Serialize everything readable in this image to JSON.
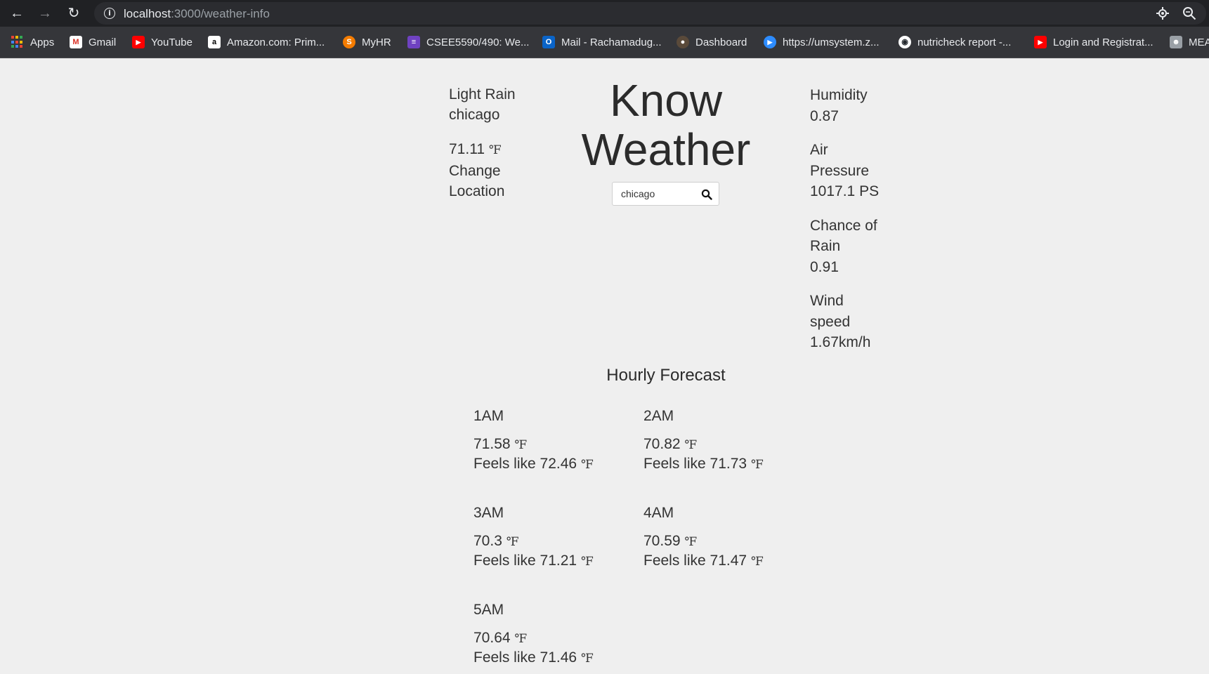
{
  "browser": {
    "url_host": "localhost",
    "url_path": ":3000/weather-info",
    "bookmarks": [
      {
        "label": "Apps",
        "icon": "apps-grid-icon"
      },
      {
        "label": "Gmail",
        "icon": "gmail-icon"
      },
      {
        "label": "YouTube",
        "icon": "youtube-icon"
      },
      {
        "label": "Amazon.com: Prim...",
        "icon": "amazon-icon"
      },
      {
        "label": "MyHR",
        "icon": "myhr-icon"
      },
      {
        "label": "CSEE5590/490: We...",
        "icon": "list-icon"
      },
      {
        "label": "Mail - Rachamadug...",
        "icon": "outlook-icon"
      },
      {
        "label": "Dashboard",
        "icon": "dashboard-icon"
      },
      {
        "label": "https://umsystem.z...",
        "icon": "zoom-icon"
      },
      {
        "label": "nutricheck report -...",
        "icon": "github-icon"
      },
      {
        "label": "Login and Registrat...",
        "icon": "youtube-icon"
      },
      {
        "label": "MEA",
        "icon": "avatar-icon"
      }
    ]
  },
  "current": {
    "condition": "Light Rain",
    "city": "chicago",
    "temp": "71.11",
    "unit": "℉",
    "change_line1": "Change",
    "change_line2": "Location"
  },
  "header": {
    "title_line1": "Know",
    "title_line2": "Weather"
  },
  "search": {
    "value": "chicago"
  },
  "stats": {
    "humidity_label": "Humidity",
    "humidity_value": "0.87",
    "pressure_label_1": "Air",
    "pressure_label_2": "Pressure",
    "pressure_value": "1017.1 PS",
    "rain_label_1": "Chance of",
    "rain_label_2": "Rain",
    "rain_value": "0.91",
    "wind_label_1": "Wind",
    "wind_label_2": "speed",
    "wind_value": "1.67km/h"
  },
  "forecast": {
    "title": "Hourly Forecast",
    "feels_prefix": "Feels like",
    "unit": "℉",
    "hours": [
      {
        "time": "1AM",
        "temp": "71.58",
        "feels": "72.46"
      },
      {
        "time": "2AM",
        "temp": "70.82",
        "feels": "71.73"
      },
      {
        "time": "3AM",
        "temp": "70.3",
        "feels": "71.21"
      },
      {
        "time": "4AM",
        "temp": "70.59",
        "feels": "71.47"
      },
      {
        "time": "5AM",
        "temp": "70.64",
        "feels": "71.46"
      }
    ]
  }
}
